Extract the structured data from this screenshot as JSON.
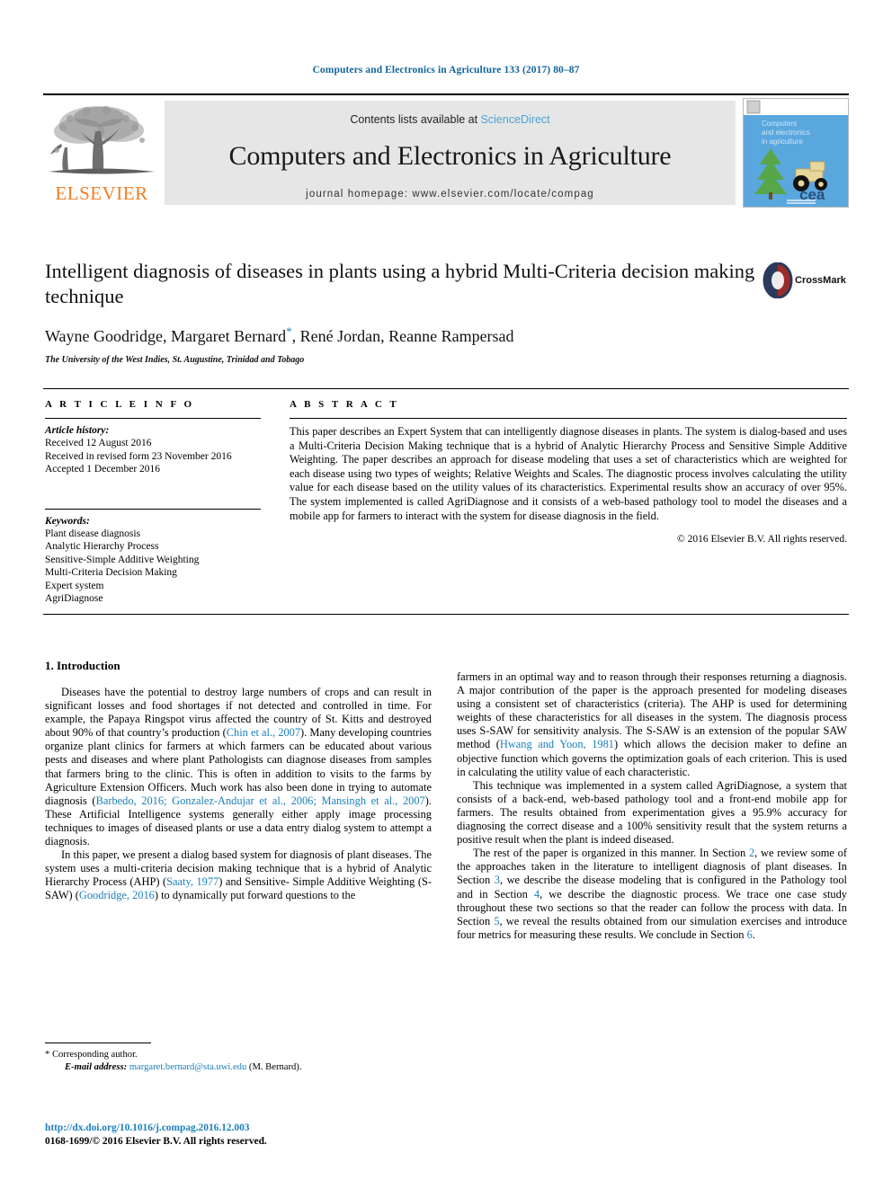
{
  "running_head": "Computers and Electronics in Agriculture 133 (2017) 80–87",
  "masthead": {
    "publisher_name": "ELSEVIER",
    "contents_prefix": "Contents lists available at ",
    "contents_link": "ScienceDirect",
    "journal_title": "Computers and Electronics in Agriculture",
    "homepage": "journal homepage: www.elsevier.com/locate/compag",
    "cover_lines": [
      "Computers",
      "and electronics",
      "in agriculture"
    ],
    "cover_mark": "cea"
  },
  "article": {
    "title": "Intelligent diagnosis of diseases in plants using a hybrid Multi-Criteria decision making technique",
    "authors": "Wayne Goodridge, Margaret Bernard",
    "authors_tail": ", René Jordan, Reanne Rampersad",
    "corresponding_marker": "*",
    "affiliation": "The University of the West Indies, St. Augustine, Trinidad and Tobago",
    "crossmark_label": "CrossMark"
  },
  "info": {
    "heading": "A R T I C L E   I N F O",
    "history_label": "Article history:",
    "history": [
      "Received 12 August 2016",
      "Received in revised form 23 November 2016",
      "Accepted 1 December 2016"
    ],
    "keywords_label": "Keywords:",
    "keywords": [
      "Plant disease diagnosis",
      "Analytic Hierarchy Process",
      "Sensitive-Simple Additive Weighting",
      "Multi-Criteria Decision Making",
      "Expert system",
      "AgriDiagnose"
    ]
  },
  "abstract": {
    "heading": "A B S T R A C T",
    "text": "This paper describes an Expert System that can intelligently diagnose diseases in plants. The system is dialog-based and uses a Multi-Criteria Decision Making technique that is a hybrid of Analytic Hierarchy Process and Sensitive Simple Additive Weighting. The paper describes an approach for disease modeling that uses a set of characteristics which are weighted for each disease using two types of weights; Relative Weights and Scales. The diagnostic process involves calculating the utility value for each disease based on the utility values of its characteristics. Experimental results show an accuracy of over 95%. The system implemented is called AgriDiagnose and it consists of a web-based pathology tool to model the diseases and a mobile app for farmers to interact with the system for disease diagnosis in the field.",
    "copyright": "© 2016 Elsevier B.V. All rights reserved."
  },
  "introduction": {
    "section_title": "1. Introduction",
    "left_paragraphs": [
      {
        "parts": [
          {
            "t": "Diseases have the potential to destroy large numbers of crops and can result in significant losses and food shortages if not detected and controlled in time. For example, the Papaya Ringspot virus affected the country of St. Kitts and destroyed about 90% of that country’s production (",
            "link": false
          },
          {
            "t": "Chin et al., 2007",
            "link": true
          },
          {
            "t": "). Many developing countries organize plant clinics for farmers at which farmers can be educated about various pests and diseases and where plant Pathologists can diagnose diseases from samples that farmers bring to the clinic. This is often in addition to visits to the farms by Agriculture Extension Officers. Much work has also been done in trying to automate diagnosis (",
            "link": false
          },
          {
            "t": "Barbedo, 2016; Gonzalez-Andujar et al., 2006; Mansingh et al., 2007",
            "link": true
          },
          {
            "t": "). These Artificial Intelligence systems generally either apply image processing techniques to images of diseased plants or use a data entry dialog system to attempt a diagnosis.",
            "link": false
          }
        ]
      },
      {
        "parts": [
          {
            "t": "In this paper, we present a dialog based system for diagnosis of plant diseases. The system uses a multi-criteria decision making technique that is a hybrid of Analytic Hierarchy Process (AHP) (",
            "link": false
          },
          {
            "t": "Saaty, 1977",
            "link": true
          },
          {
            "t": ") and Sensitive- Simple Additive Weighting (S-SAW) (",
            "link": false
          },
          {
            "t": "Goodridge, 2016",
            "link": true
          },
          {
            "t": ") to dynamically put forward questions to the",
            "link": false
          }
        ]
      }
    ],
    "right_paragraphs": [
      {
        "indent": false,
        "parts": [
          {
            "t": "farmers in an optimal way and to reason through their responses returning a diagnosis. A major contribution of the paper is the approach presented for modeling diseases using a consistent set of characteristics (criteria). The AHP is used for determining weights of these characteristics for all diseases in the system. The diagnosis process uses S-SAW for sensitivity analysis. The S-SAW is an extension of the popular SAW method (",
            "link": false
          },
          {
            "t": "Hwang and Yoon, 1981",
            "link": true
          },
          {
            "t": ") which allows the decision maker to define an objective function which governs the optimization goals of each criterion. This is used in calculating the utility value of each characteristic.",
            "link": false
          }
        ]
      },
      {
        "indent": true,
        "parts": [
          {
            "t": "This technique was implemented in a system called AgriDiagnose, a system that consists of a back-end, web-based pathology tool and a front-end mobile app for farmers. The results obtained from experimentation gives a 95.9% accuracy for diagnosing the correct disease and a 100% sensitivity result that the system returns a positive result when the plant is indeed diseased.",
            "link": false
          }
        ]
      },
      {
        "indent": true,
        "parts": [
          {
            "t": "The rest of the paper is organized in this manner. In Section ",
            "link": false
          },
          {
            "t": "2",
            "link": true
          },
          {
            "t": ", we review some of the approaches taken in the literature to intelligent diagnosis of plant diseases. In Section ",
            "link": false
          },
          {
            "t": "3",
            "link": true
          },
          {
            "t": ", we describe the disease modeling that is configured in the Pathology tool and in Section ",
            "link": false
          },
          {
            "t": "4",
            "link": true
          },
          {
            "t": ", we describe the diagnostic process. We trace one case study throughout these two sections so that the reader can follow the process with data. In Section ",
            "link": false
          },
          {
            "t": "5",
            "link": true
          },
          {
            "t": ", we reveal the results obtained from our simulation exercises and introduce four metrics for measuring these results. We conclude in Section ",
            "link": false
          },
          {
            "t": "6",
            "link": true
          },
          {
            "t": ".",
            "link": false
          }
        ]
      }
    ]
  },
  "footnote": {
    "corresponding": "* Corresponding author.",
    "email_label": "E-mail address:",
    "email": "margaret.bernard@sta.uwi.edu",
    "email_suffix": " (M. Bernard)."
  },
  "footer": {
    "doi": "http://dx.doi.org/10.1016/j.compag.2016.12.003",
    "issn": "0168-1699/© 2016 Elsevier B.V. All rights reserved."
  },
  "colors": {
    "link": "#1b7fba",
    "running_head": "#12659c",
    "elsevier_orange": "#f07e26",
    "sciencedirect": "#4aa3d8",
    "masthead_bg": "#e6e6e6"
  }
}
